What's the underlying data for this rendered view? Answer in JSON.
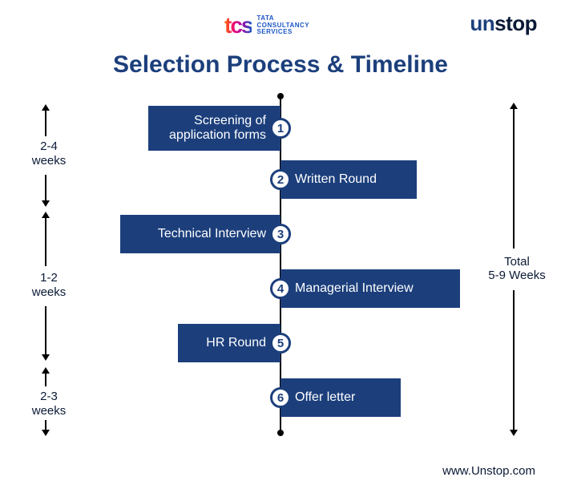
{
  "brand": {
    "tcs_word": "tcs",
    "tcs_sub_line1": "TATA",
    "tcs_sub_line2": "CONSULTANCY",
    "tcs_sub_line3": "SERVICES",
    "unstop_prefix": "un",
    "unstop_suffix": "stop"
  },
  "title": "Selection Process & Timeline",
  "steps": [
    {
      "n": "1",
      "label": "Screening of\napplication forms"
    },
    {
      "n": "2",
      "label": "Written Round"
    },
    {
      "n": "3",
      "label": "Technical Interview"
    },
    {
      "n": "4",
      "label": "Managerial Interview"
    },
    {
      "n": "5",
      "label": "HR Round"
    },
    {
      "n": "6",
      "label": "Offer letter"
    }
  ],
  "durations": [
    {
      "label": "2-4\nweeks"
    },
    {
      "label": "1-2\nweeks"
    },
    {
      "label": "2-3\nweeks"
    }
  ],
  "total_label": "Total\n5-9 Weeks",
  "footer_url": "www.Unstop.com",
  "chart_data": {
    "type": "table",
    "title": "Selection Process & Timeline",
    "process_steps": [
      "Screening of application forms",
      "Written Round",
      "Technical Interview",
      "Managerial Interview",
      "HR Round",
      "Offer letter"
    ],
    "segment_durations_weeks": [
      {
        "steps": [
          1,
          2
        ],
        "min": 2,
        "max": 4
      },
      {
        "steps": [
          3,
          4,
          5
        ],
        "min": 1,
        "max": 2
      },
      {
        "steps": [
          6
        ],
        "min": 2,
        "max": 3
      }
    ],
    "total_weeks": {
      "min": 5,
      "max": 9
    }
  }
}
